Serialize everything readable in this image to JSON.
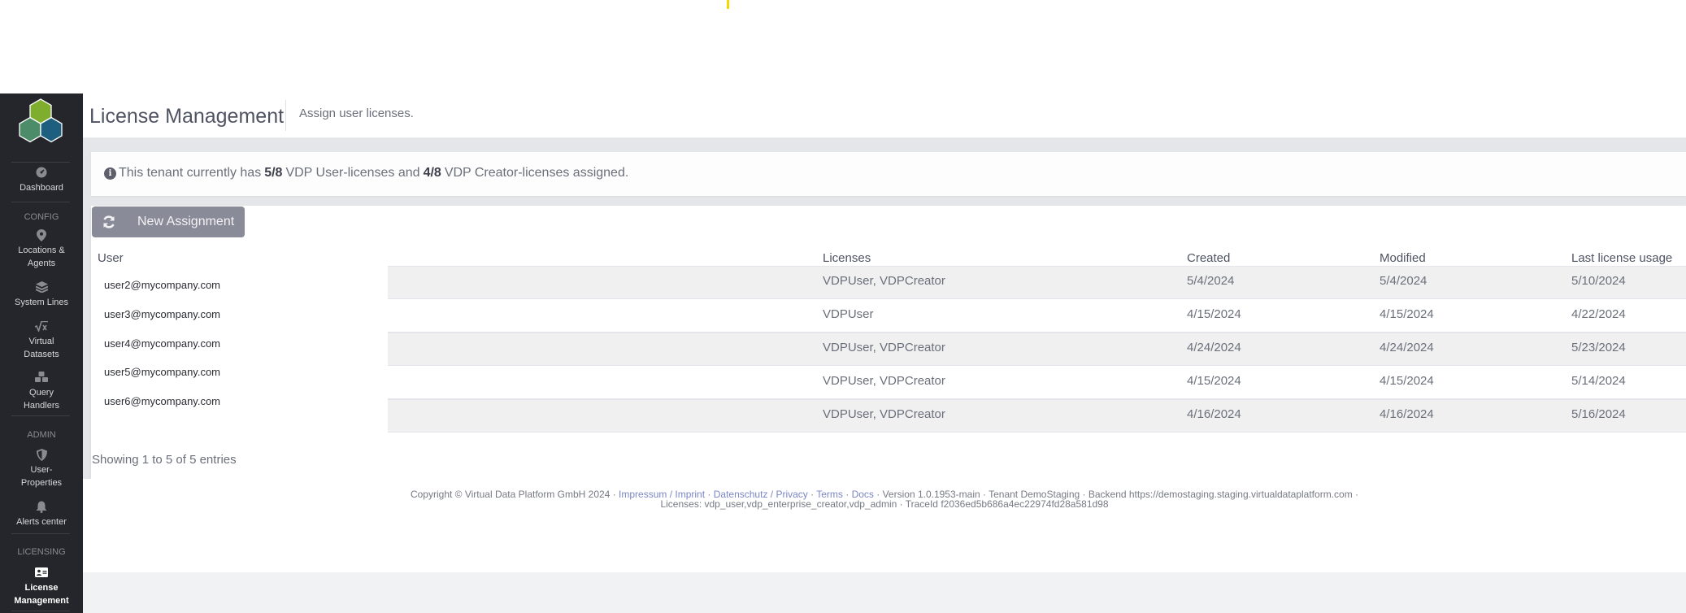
{
  "sidebar": {
    "items": [
      {
        "label": "Dashboard",
        "icon": "dashboard-icon"
      },
      {
        "label": "Locations &",
        "label2": "Agents",
        "icon": "map-marker-icon"
      },
      {
        "label": "System Lines",
        "icon": "layers-icon"
      },
      {
        "label": "Virtual",
        "label2": "Datasets",
        "icon": "square-root-icon"
      },
      {
        "label": "Query",
        "label2": "Handlers",
        "icon": "cubes-icon"
      },
      {
        "label": "User-",
        "label2": "Properties",
        "icon": "shield-icon"
      },
      {
        "label": "Alerts center",
        "icon": "bell-icon"
      },
      {
        "label": "License",
        "label2": "Management",
        "icon": "id-card-icon",
        "active": true
      }
    ],
    "sections": {
      "config": "CONFIG",
      "admin": "ADMIN",
      "licensing": "LICENSING"
    }
  },
  "header": {
    "title": "License Management",
    "subtitle": "Assign user licenses."
  },
  "info": {
    "prefix": "This tenant currently has",
    "user_count": "5/8",
    "middle": "VDP User-licenses and",
    "creator_count": "4/8",
    "suffix": "VDP Creator-licenses assigned."
  },
  "toolbar": {
    "new_assignment_label": "New Assignment"
  },
  "table": {
    "columns": [
      "User",
      "Licenses",
      "Created",
      "Modified",
      "Last license usage"
    ],
    "rows": [
      {
        "user": "user2@mycompany.com",
        "licenses": "VDPUser, VDPCreator",
        "created": "5/4/2024",
        "modified": "5/4/2024",
        "last_usage": "5/10/2024"
      },
      {
        "user": "user3@mycompany.com",
        "licenses": "VDPUser",
        "created": "4/15/2024",
        "modified": "4/15/2024",
        "last_usage": "4/22/2024"
      },
      {
        "user": "user4@mycompany.com",
        "licenses": "VDPUser, VDPCreator",
        "created": "4/24/2024",
        "modified": "4/24/2024",
        "last_usage": "5/23/2024"
      },
      {
        "user": "user5@mycompany.com",
        "licenses": "VDPUser, VDPCreator",
        "created": "4/15/2024",
        "modified": "4/15/2024",
        "last_usage": "5/14/2024"
      },
      {
        "user": "user6@mycompany.com",
        "licenses": "VDPUser, VDPCreator",
        "created": "4/16/2024",
        "modified": "4/16/2024",
        "last_usage": "5/16/2024"
      }
    ],
    "showing": "Showing 1 to 5 of 5 entries"
  },
  "footer": {
    "copyright": "Copyright © Virtual Data Platform GmbH 2024 · ",
    "impressum": "Impressum / Imprint",
    "sep1": " · ",
    "privacy": "Datenschutz / Privacy",
    "sep2": " · ",
    "terms": "Terms",
    "sep3": " · ",
    "docs": "Docs",
    "rest": " · Version 1.0.1953-main · Tenant DemoStaging · Backend https://demostaging.staging.virtualdataplatform.com ·",
    "line2": "Licenses: vdp_user,vdp_enterprise_creator,vdp_admin · TraceId f2036ed5b686a4ec22974fd28a581d98"
  },
  "colors": {
    "sidebar_bg": "#25262b",
    "button_bg": "#8a8b98",
    "link": "#7b86c6",
    "logo_green": "#7fad2e",
    "logo_teal": "#4c8c68",
    "logo_blue": "#1e5f80"
  }
}
